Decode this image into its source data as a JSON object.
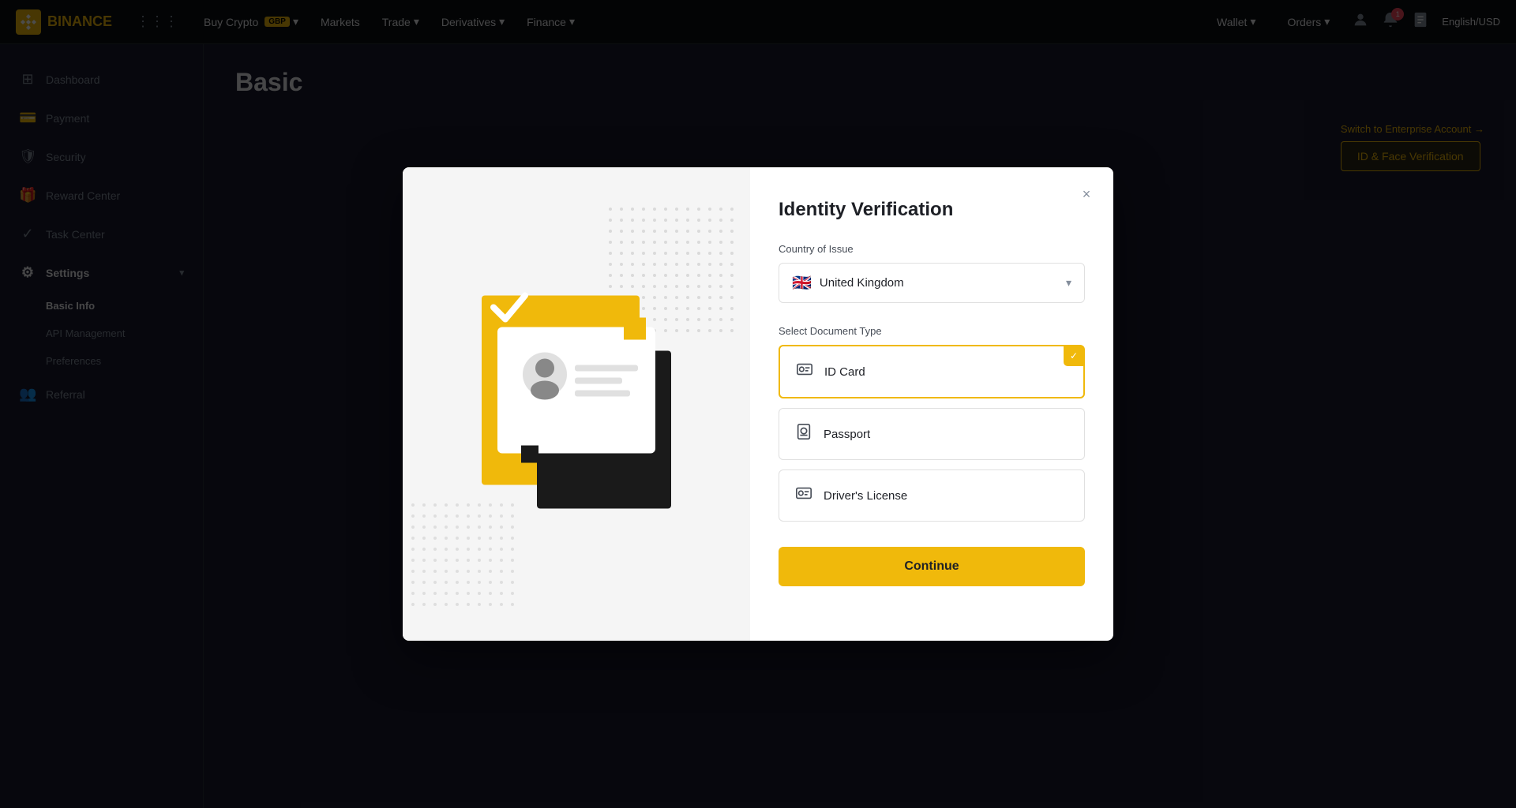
{
  "navbar": {
    "logo": "BINANCE",
    "buyCrypto": "Buy Crypto",
    "badge": "GBP",
    "markets": "Markets",
    "trade": "Trade",
    "derivatives": "Derivatives",
    "finance": "Finance",
    "wallet": "Wallet",
    "orders": "Orders",
    "language": "English/USD",
    "notifCount": "1"
  },
  "sidebar": {
    "items": [
      {
        "label": "Dashboard",
        "icon": "⊞"
      },
      {
        "label": "Payment",
        "icon": "💳"
      },
      {
        "label": "Security",
        "icon": "🛡"
      },
      {
        "label": "Reward Center",
        "icon": "🎁"
      },
      {
        "label": "Task Center",
        "icon": "✓"
      },
      {
        "label": "Settings",
        "icon": "⚙"
      }
    ],
    "subItems": [
      {
        "label": "Basic Info"
      },
      {
        "label": "API Management"
      },
      {
        "label": "Preferences"
      }
    ],
    "referral": {
      "label": "Referral",
      "icon": "👥"
    }
  },
  "page": {
    "title": "Basic",
    "enterpriseLink": "Switch to Enterprise Account →",
    "verifyBtn": "ID & Face Verification"
  },
  "modal": {
    "title": "Identity Verification",
    "closeIcon": "×",
    "countryLabel": "Country of Issue",
    "country": "United Kingdom",
    "flagEmoji": "🇬🇧",
    "documentLabel": "Select Document Type",
    "documents": [
      {
        "id": "id-card",
        "label": "ID Card",
        "icon": "🪪",
        "selected": true
      },
      {
        "id": "passport",
        "label": "Passport",
        "icon": "📔",
        "selected": false
      },
      {
        "id": "drivers-license",
        "label": "Driver's License",
        "icon": "🪪",
        "selected": false
      }
    ],
    "continueBtn": "Continue"
  }
}
